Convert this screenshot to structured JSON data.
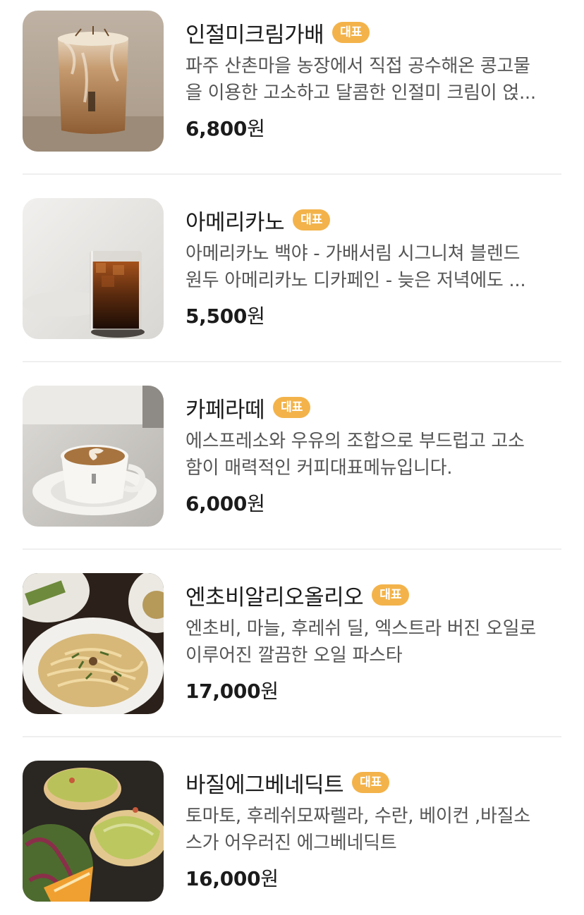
{
  "menu": {
    "items": [
      {
        "name": "인절미크림가배",
        "badge": "대표",
        "desc_line1": "파주 산촌마을 농장에서 직접 공수해온 콩고물",
        "desc_line2": "을 이용한 고소하고 달콤한 인절미 크림이 얹...",
        "price": "6,800",
        "currency": "원",
        "image": "iced-injeolmi-cream-coffee"
      },
      {
        "name": "아메리카노",
        "badge": "대표",
        "desc_line1": "아메리카노 백야 - 가배서림 시그니쳐 블렌드",
        "desc_line2": "원두 아메리카노 디카페인 - 늦은 저녁에도 ...",
        "price": "5,500",
        "currency": "원",
        "image": "iced-americano"
      },
      {
        "name": "카페라떼",
        "badge": "대표",
        "desc_line1": "에스프레소와 우유의 조합으로 부드럽고 고소",
        "desc_line2": "함이 매력적인 커피대표메뉴입니다.",
        "price": "6,000",
        "currency": "원",
        "image": "hot-cafe-latte"
      },
      {
        "name": "엔초비알리오올리오",
        "badge": "대표",
        "desc_line1": "엔초비, 마늘, 후레쉬 딜, 엑스트라 버진 오일로",
        "desc_line2": "이루어진 깔끔한 오일 파스타",
        "price": "17,000",
        "currency": "원",
        "image": "anchovy-aglio-olio-pasta"
      },
      {
        "name": "바질에그베네딕트",
        "badge": "대표",
        "desc_line1": "토마토, 후레쉬모짜렐라, 수란, 베이컨 ,바질소",
        "desc_line2": "스가 어우러진 에그베네딕트",
        "price": "16,000",
        "currency": "원",
        "image": "basil-eggs-benedict"
      }
    ]
  },
  "colors": {
    "badge_bg": "#f3b34a",
    "badge_text": "#ffffff",
    "name_text": "#1b1b1b",
    "desc_text": "#555555",
    "divider": "#efefef"
  }
}
